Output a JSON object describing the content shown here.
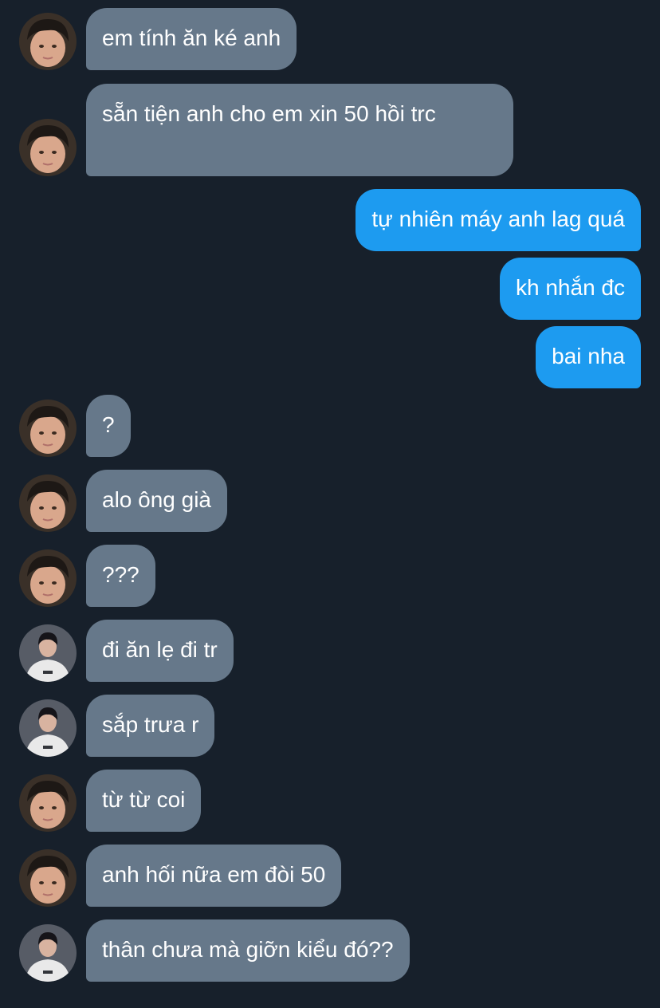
{
  "messages": [
    {
      "dir": "in",
      "text": "em tính ăn ké anh",
      "avatar": "face-avatar"
    },
    {
      "dir": "in",
      "text": "sẵn tiện anh cho em xin 50 hồi trc",
      "avatar": "face-avatar"
    },
    {
      "dir": "out",
      "text": "tự nhiên máy anh lag quá"
    },
    {
      "dir": "out",
      "text": "kh nhắn đc"
    },
    {
      "dir": "out",
      "text": "bai nha"
    },
    {
      "dir": "in",
      "text": "?",
      "avatar": "face-avatar"
    },
    {
      "dir": "in",
      "text": "alo ông già",
      "avatar": "face-avatar"
    },
    {
      "dir": "in",
      "text": "???",
      "avatar": "face-avatar"
    },
    {
      "dir": "in",
      "text": "đi ăn lẹ đi tr",
      "avatar": "jacket-avatar"
    },
    {
      "dir": "in",
      "text": "sắp trưa r",
      "avatar": "jacket-avatar"
    },
    {
      "dir": "in",
      "text": "từ từ coi",
      "avatar": "face-avatar"
    },
    {
      "dir": "in",
      "text": "anh hối nữa em đòi 50",
      "avatar": "face-avatar"
    },
    {
      "dir": "in",
      "text": "thân chưa mà giỡn kiểu đó??",
      "avatar": "jacket-avatar"
    }
  ],
  "avatars": {
    "face-avatar": {
      "label": "face-avatar",
      "colors": {
        "bg": "#3a3028",
        "skin": "#d9a78c",
        "hair": "#1d1815"
      }
    },
    "jacket-avatar": {
      "label": "jacket-avatar",
      "colors": {
        "bg": "#575c66",
        "skin": "#d8b3a0",
        "hair": "#151419",
        "jacket": "#e9e9e9"
      }
    }
  },
  "colors": {
    "background": "#17202b",
    "incoming_bubble": "#66788a",
    "outgoing_bubble": "#1d9bf0",
    "text": "#ffffff"
  }
}
